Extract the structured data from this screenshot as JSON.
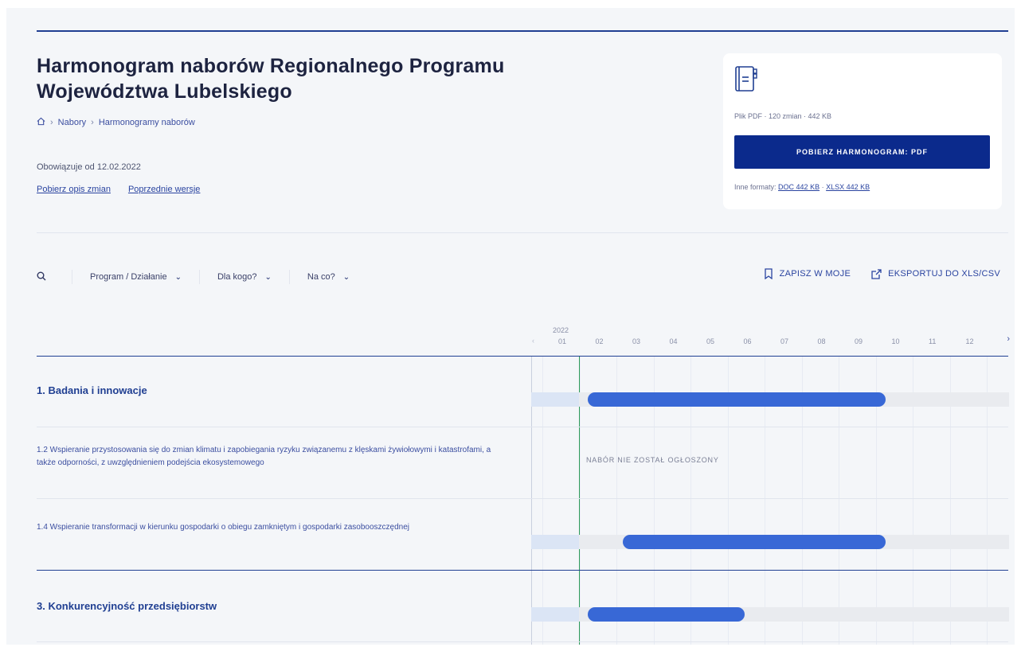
{
  "header": {
    "title": "Harmonogram naborów Regionalnego Programu Województwa Lubelskiego",
    "breadcrumb": [
      "Nabory",
      "Harmonogramy naborów"
    ],
    "valid_from": "Obowiązuje od 12.02.2022",
    "link_changes": "Pobierz opis zmian",
    "link_versions": "Poprzednie wersje"
  },
  "download": {
    "meta": "Plik PDF · 120 zmian · 442 KB",
    "button": "POBIERZ HARMONOGRAM: PDF",
    "other_formats_label": "Inne formaty:",
    "doc_link": "DOC 442 KB",
    "separator": "·",
    "xlsx_link": "XLSX 442 KB"
  },
  "filters": {
    "program": "Program / Działanie",
    "for_whom": "Dla kogo?",
    "for_what": "Na co?"
  },
  "actions": {
    "save": "ZAPISZ W MOJE",
    "export": "EKSPORTUJ DO XLS/CSV"
  },
  "timeline": {
    "year": "2022",
    "months": [
      "01",
      "02",
      "03",
      "04",
      "05",
      "06",
      "07",
      "08",
      "09",
      "10",
      "11",
      "12"
    ]
  },
  "rows": [
    {
      "type": "group",
      "label": "1. Badania i innowacje",
      "bar_start_month": 2.05,
      "bar_end_month": 10.1
    },
    {
      "type": "item",
      "label": "1.2 Wspieranie przystosowania się do zmian klimatu i zapobiegania ryzyku związanemu z klęskami żywiołowymi i katastrofami, a także odporności, z uwzględnieniem podejścia ekosystemowego",
      "status": "NABÓR NIE ZOSTAŁ OGŁOSZONY"
    },
    {
      "type": "item",
      "label": "1.4 Wspieranie transformacji w kierunku gospodarki o obiegu zamkniętym i gospodarki zasobooszczędnej",
      "bar_start_month": 3.0,
      "bar_end_month": 10.1
    },
    {
      "type": "group",
      "label": "3. Konkurencyjność przedsiębiorstw",
      "bar_start_month": 2.05,
      "bar_end_month": 6.3
    }
  ],
  "colors": {
    "accent": "#203f92",
    "button": "#0b2a8c",
    "bar": "#3868d6",
    "today_line": "#2e9b5a"
  }
}
